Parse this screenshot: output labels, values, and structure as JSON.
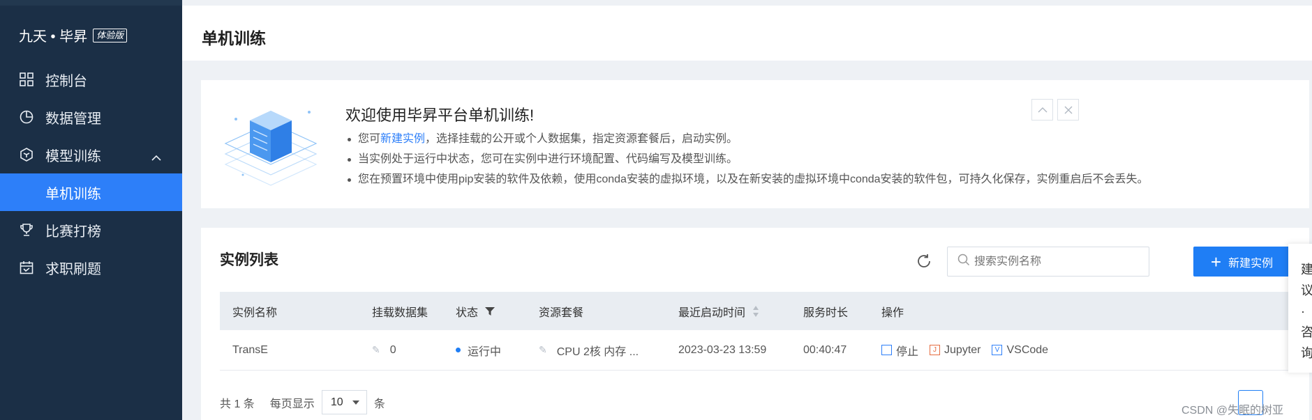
{
  "brand": {
    "name": "九天 • 毕昇",
    "edition": "体验版"
  },
  "sidebar": {
    "items": [
      {
        "label": "控制台"
      },
      {
        "label": "数据管理"
      },
      {
        "label": "模型训练"
      },
      {
        "label": "单机训练"
      },
      {
        "label": "比赛打榜"
      },
      {
        "label": "求职刷题"
      }
    ]
  },
  "header": {
    "title": "单机训练"
  },
  "welcome": {
    "title": "欢迎使用毕昇平台单机训练!",
    "line1_prefix": "您可",
    "line1_link": "新建实例",
    "line1_suffix": "，选择挂载的公开或个人数据集，指定资源套餐后，启动实例。",
    "line2": "当实例处于运行中状态，您可在实例中进行环境配置、代码编写及模型训练。",
    "line3": "您在预置环境中使用pip安装的软件及依赖，使用conda安装的虚拟环境，以及在新安装的虚拟环境中conda安装的软件包，可持久化保存，实例重启后不会丢失。"
  },
  "list": {
    "title": "实例列表",
    "search_placeholder": "搜索实例名称",
    "new_button": "新建实例",
    "columns": {
      "name": "实例名称",
      "dataset": "挂载数据集",
      "status": "状态",
      "package": "资源套餐",
      "last_start": "最近启动时间",
      "duration": "服务时长",
      "actions": "操作"
    },
    "rows": [
      {
        "name": "TransE",
        "dataset_count": "0",
        "status": "运行中",
        "package": "CPU 2核 内存 ...",
        "last_start": "2023-03-23 13:59",
        "duration": "00:40:47",
        "action_stop": "停止",
        "action_jupyter": "Jupyter",
        "action_vscode": "VSCode"
      }
    ]
  },
  "pager": {
    "total": "共 1 条",
    "per_page_label": "每页显示",
    "per_page_value": "10",
    "unit": "条"
  },
  "float_panel": {
    "text": "建议 · 咨询"
  },
  "watermark": "CSDN @失眠的树亚",
  "colors": {
    "sidebar": "#1b2f46",
    "accent": "#1f7ef5",
    "active": "#2d7ff9"
  }
}
